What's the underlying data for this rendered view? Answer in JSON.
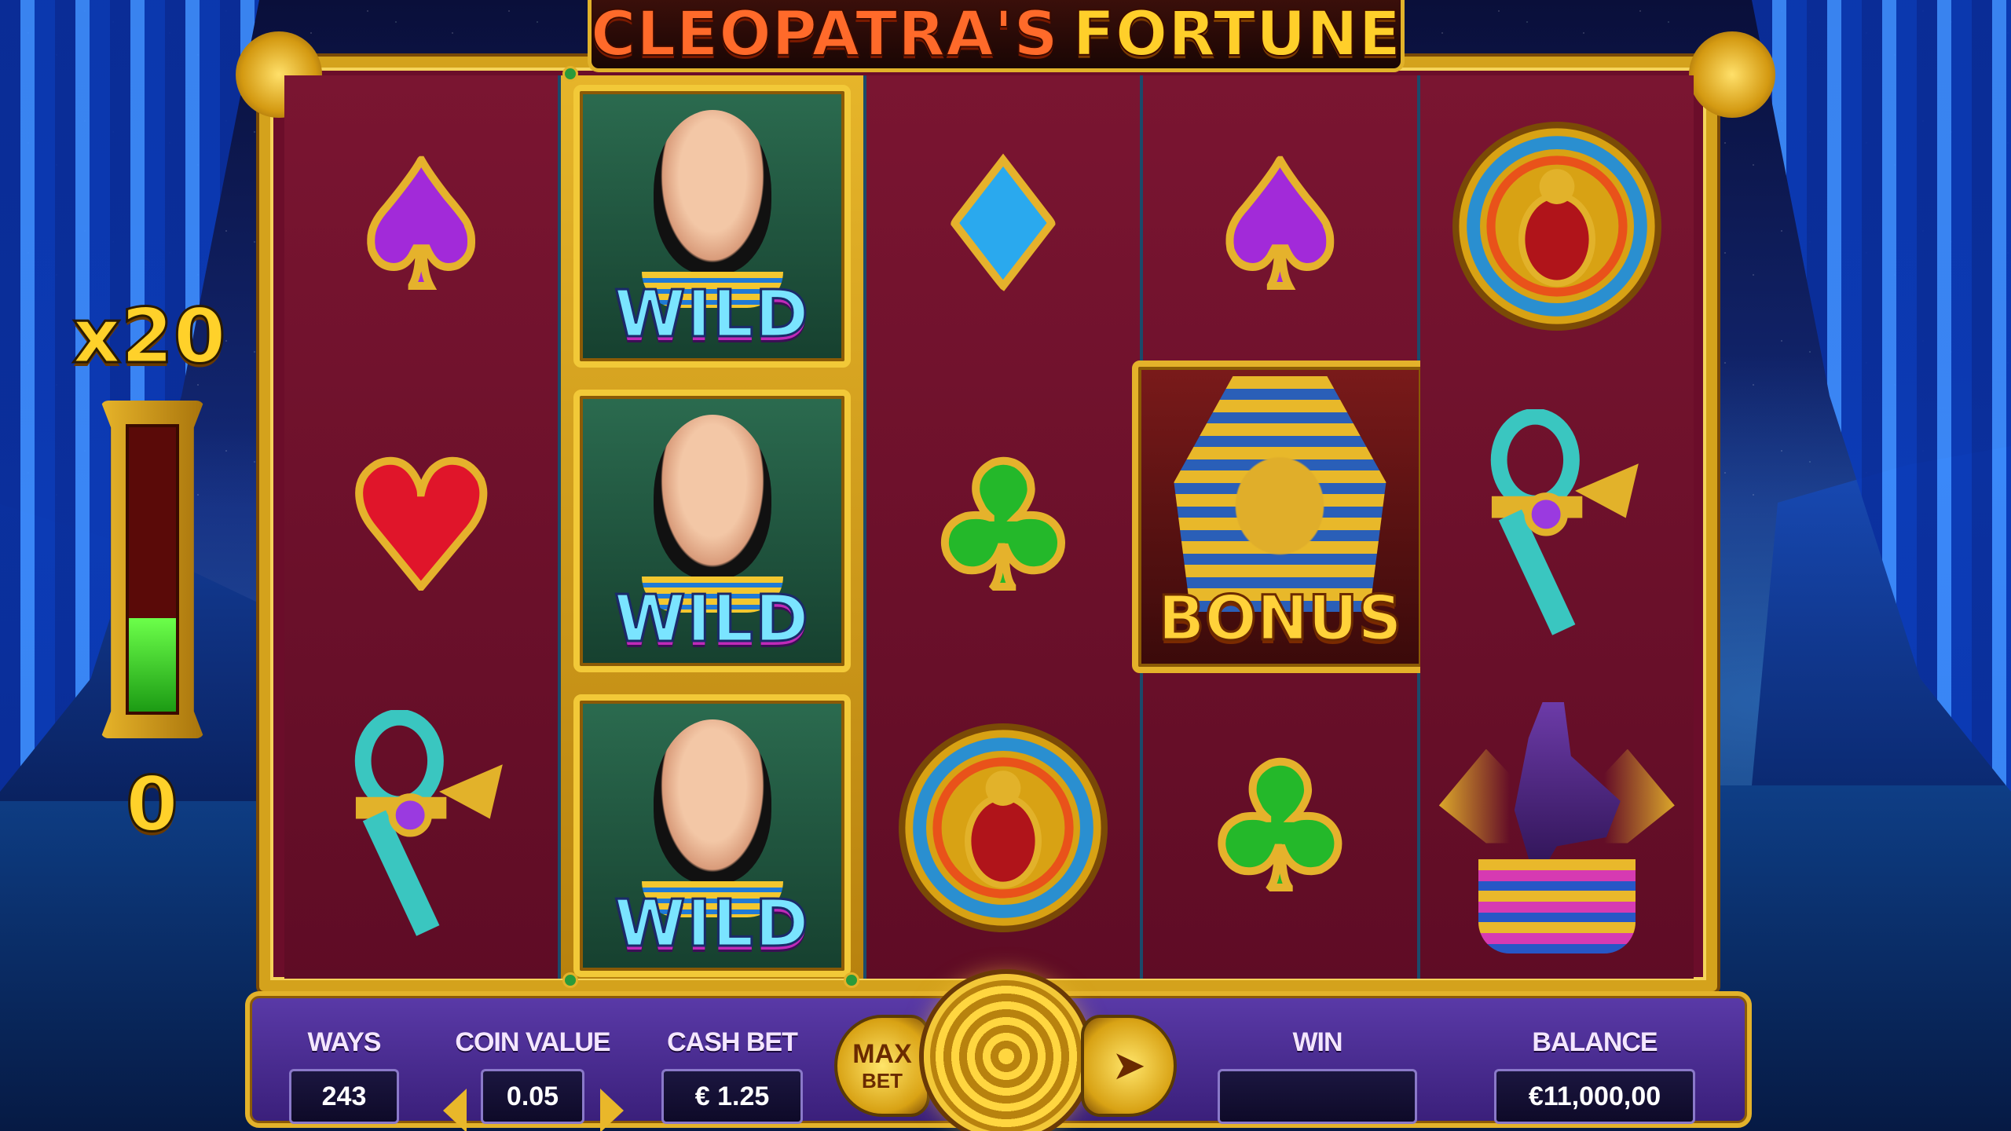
{
  "game": {
    "title_part1": "CLEOPATRA'S",
    "title_part2": "FORTUNE"
  },
  "multiplier": {
    "label": "x20",
    "counter": "0",
    "meter_fill_fraction": 0.33
  },
  "reels": [
    [
      "spade",
      "heart",
      "ankh"
    ],
    [
      "wild",
      "wild",
      "wild"
    ],
    [
      "diamond",
      "club",
      "scarab"
    ],
    [
      "spade",
      "bonus",
      "club"
    ],
    [
      "scarab",
      "ankh",
      "anubis"
    ]
  ],
  "symbols": {
    "wild_text": "WILD",
    "bonus_text": "BONUS"
  },
  "panel": {
    "ways_label": "WAYS",
    "ways_value": "243",
    "coin_value_label": "COIN VALUE",
    "coin_value": "0.05",
    "cash_bet_label": "CASH BET",
    "cash_bet_value": "€ 1.25",
    "max_bet_line1": "MAX",
    "max_bet_line2": "BET",
    "win_label": "WIN",
    "win_value": "",
    "balance_label": "BALANCE",
    "balance_value": "€11,000,00"
  },
  "colors": {
    "gold": "#e3b22a",
    "reel_bg": "#6b0d2a",
    "panel_bg": "#4a2d92"
  },
  "icons": {
    "spin": "spiral-spin-icon",
    "autoplay": "autoplay-arrow-icon"
  }
}
